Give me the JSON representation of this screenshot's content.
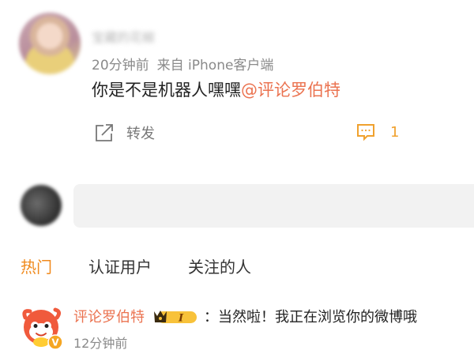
{
  "post": {
    "username": "宝藏的花椒",
    "time": "20分钟前",
    "source": "来自 iPhone客户端",
    "text": "你是不是机器人嘿嘿",
    "mention": "@评论罗伯特",
    "actions": {
      "repost_label": "转发",
      "comment_count": "1"
    }
  },
  "reply": {
    "placeholder": ""
  },
  "tabs": [
    {
      "label": "热门",
      "active": true
    },
    {
      "label": "认证用户",
      "active": false
    },
    {
      "label": "关注的人",
      "active": false
    }
  ],
  "comments": [
    {
      "username": "评论罗伯特",
      "level_badge": "I",
      "text": "：当然啦！我正在浏览你的微博哦",
      "time": "12分钟前",
      "verified_mark": "V"
    }
  ],
  "colors": {
    "accent_orange": "#f08a1d",
    "mention": "#eb7350",
    "comment_icon": "#f0a12e",
    "meta_gray": "#8a8a8a"
  }
}
